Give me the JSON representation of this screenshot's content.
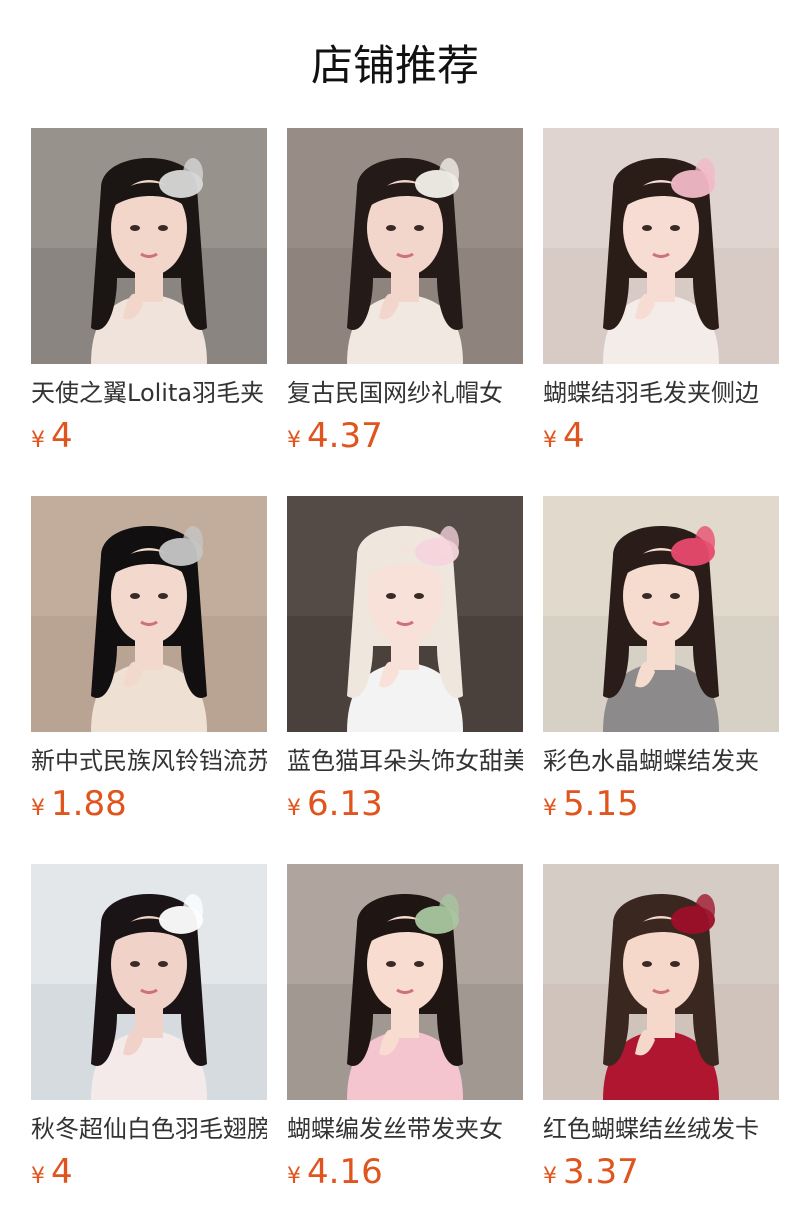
{
  "section": {
    "title": "店铺推荐"
  },
  "products": [
    {
      "name": "天使之翼Lolita羽毛夹",
      "currency": "¥",
      "price": "4",
      "photo": {
        "bg": "#8a8580",
        "wall": "#a29c96",
        "hair": "#1b1514",
        "skin": "#f1d6c9",
        "top": "#efe3dc",
        "accent": "#d9d9d9"
      }
    },
    {
      "name": "复古民国网纱礼帽女",
      "currency": "¥",
      "price": "4.37",
      "photo": {
        "bg": "#8f837d",
        "wall": "#a1948e",
        "hair": "#241a18",
        "skin": "#f3d6cb",
        "top": "#f2e8e2",
        "accent": "#f4f0ea"
      }
    },
    {
      "name": "蝴蝶结羽毛发夹侧边",
      "currency": "¥",
      "price": "4",
      "photo": {
        "bg": "#d8cbc6",
        "wall": "#e6dcd8",
        "hair": "#2a1c16",
        "skin": "#f6dcd2",
        "top": "#f3ece9",
        "accent": "#f2b9c6"
      }
    },
    {
      "name": "新中式民族风铃铛流苏",
      "currency": "¥",
      "price": "1.88",
      "photo": {
        "bg": "#b9a392",
        "wall": "#cbb7a6",
        "hair": "#120f10",
        "skin": "#f3d9cd",
        "top": "#efe0d4",
        "accent": "#c7c7c7"
      }
    },
    {
      "name": "蓝色猫耳朵头饰女甜美",
      "currency": "¥",
      "price": "6.13",
      "photo": {
        "bg": "#4a403c",
        "wall": "#5d5450",
        "hair": "#efe6dd",
        "skin": "#f7e1d8",
        "top": "#f3f3f3",
        "accent": "#f7d6df"
      }
    },
    {
      "name": "彩色水晶蝴蝶结发夹",
      "currency": "¥",
      "price": "5.15",
      "photo": {
        "bg": "#d7d0c4",
        "wall": "#e7e0d4",
        "hair": "#2a1d19",
        "skin": "#f5dccf",
        "top": "#8c8a8a",
        "accent": "#e84a6e"
      }
    },
    {
      "name": "秋冬超仙白色羽毛翅膀",
      "currency": "¥",
      "price": "4",
      "photo": {
        "bg": "#d6dbe0",
        "wall": "#eef1f2",
        "hair": "#1a1416",
        "skin": "#f0d2c8",
        "top": "#f4eaea",
        "accent": "#ffffff"
      }
    },
    {
      "name": "蝴蝶编发丝带发夹女",
      "currency": "¥",
      "price": "4.16",
      "photo": {
        "bg": "#a29892",
        "wall": "#b9afa8",
        "hair": "#1f1614",
        "skin": "#f7dccf",
        "top": "#f4c5cf",
        "accent": "#a8c7a0"
      }
    },
    {
      "name": "红色蝴蝶结丝绒发卡",
      "currency": "¥",
      "price": "3.37",
      "photo": {
        "bg": "#cfc3bc",
        "wall": "#ddd3cd",
        "hair": "#3a2820",
        "skin": "#f5d8c9",
        "top": "#b0162f",
        "accent": "#9c0f29"
      }
    }
  ]
}
